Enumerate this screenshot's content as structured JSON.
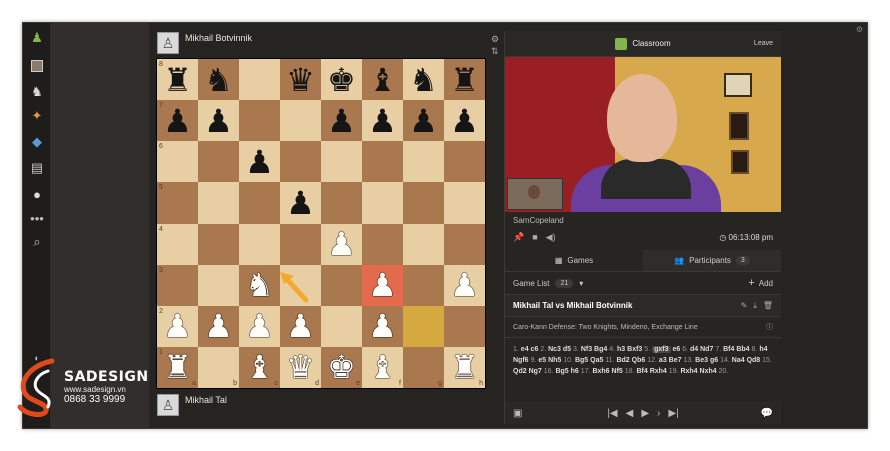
{
  "players": {
    "top": "Mikhail Botvinnik",
    "bottom": "Mikhail Tal"
  },
  "board": {
    "squares": [
      [
        "r",
        "n",
        "",
        "q",
        "k",
        "b",
        "n",
        "r"
      ],
      [
        "p",
        "p",
        "",
        "",
        "p",
        "p",
        "p",
        "p"
      ],
      [
        "",
        "",
        "p",
        "",
        "",
        "",
        "",
        ""
      ],
      [
        "",
        "",
        "",
        "p",
        "",
        "",
        "",
        ""
      ],
      [
        "",
        "",
        "",
        "",
        "P",
        "",
        "",
        ""
      ],
      [
        "",
        "",
        "N",
        "",
        "",
        "P",
        "",
        "P"
      ],
      [
        "P",
        "P",
        "P",
        "P",
        "",
        "P",
        "",
        ""
      ],
      [
        "R",
        "",
        "B",
        "Q",
        "K",
        "B",
        "",
        "R"
      ]
    ],
    "ranks": [
      "8",
      "7",
      "6",
      "5",
      "4",
      "3",
      "2",
      "1"
    ],
    "files": [
      "a",
      "b",
      "c",
      "d",
      "e",
      "f",
      "g",
      "h"
    ],
    "highlight_red": "f3",
    "highlight_yellow": "g2"
  },
  "panel": {
    "title": "Classroom",
    "leave": "Leave",
    "streamer": "SamCopeland",
    "time": "06:13:08 pm",
    "tabs": {
      "games": "Games",
      "participants": "Participants",
      "participants_count": "3"
    },
    "game_list": "Game List",
    "game_list_count": "21",
    "add": "Add",
    "game_title": "Mikhail Tal vs Mikhail Botvinnik",
    "opening": "Caro-Kann Defense: Two Knights, Mindeno, Exchange Line",
    "moves": [
      {
        "n": "1.",
        "w": "e4",
        "b": "c6"
      },
      {
        "n": "2.",
        "w": "Nc3",
        "b": "d5"
      },
      {
        "n": "3.",
        "w": "Nf3",
        "b": "Bg4"
      },
      {
        "n": "4.",
        "w": "h3",
        "b": "Bxf3"
      },
      {
        "n": "5.",
        "w": "gxf3",
        "b": "e6"
      },
      {
        "n": "6.",
        "w": "d4",
        "b": "Nd7"
      },
      {
        "n": "7.",
        "w": "Bf4",
        "b": "Bb4"
      },
      {
        "n": "8.",
        "w": "h4",
        "b": "Ngf6"
      },
      {
        "n": "9.",
        "w": "e5",
        "b": "Nh5"
      },
      {
        "n": "10.",
        "w": "Bg5",
        "b": "Qa5"
      },
      {
        "n": "11.",
        "w": "Bd2",
        "b": "Qb6"
      },
      {
        "n": "12.",
        "w": "a3",
        "b": "Be7"
      },
      {
        "n": "13.",
        "w": "Be3",
        "b": "g6"
      },
      {
        "n": "14.",
        "w": "Na4",
        "b": "Qd8"
      },
      {
        "n": "15.",
        "w": "Qd2",
        "b": "Ng7"
      },
      {
        "n": "16.",
        "w": "Bg5",
        "b": "h6"
      },
      {
        "n": "17.",
        "w": "Bxh6",
        "b": "Nf5"
      },
      {
        "n": "18.",
        "w": "Bf4",
        "b": "Rxh4"
      },
      {
        "n": "19.",
        "w": "Rxh4",
        "b": "Nxh4"
      },
      {
        "n": "20.",
        "w": "",
        "b": ""
      }
    ],
    "current_move": "gxf3"
  },
  "brand": {
    "name": "SADESIGN",
    "site": "www.sadesign.vn",
    "phone": "0868 33 9999"
  },
  "colors": {
    "light_square": "#e8cfa3",
    "dark_square": "#a9784f",
    "highlight_red": "#e46a4e",
    "highlight_yellow": "#d6a940",
    "accent_green": "#81b64c"
  }
}
